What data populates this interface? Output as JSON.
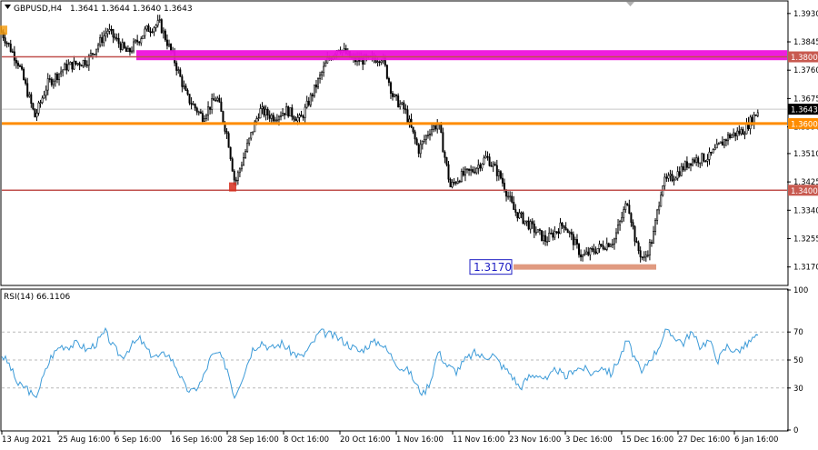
{
  "window": {
    "symbol_label": "GBPUSD,H4",
    "ohlc_label": "1.3641 1.3644 1.3640 1.3643",
    "indicator_label": "RSI(14) 66.1106"
  },
  "colors": {
    "candle": "#000000",
    "magenta_zone": "#ee11dd",
    "orange_line": "#ff8c00",
    "red_line": "#c0504d",
    "support_bar": "#e09a80",
    "rsi_line": "#3d9bd8",
    "badge_blue_border": "#1f1fc4",
    "current_price_badge": "#000000",
    "price_badge": "#c85a50",
    "marker_orange": "#f39c12",
    "marker_red": "#d62b1b"
  },
  "chart_data": [
    {
      "type": "candlestick",
      "symbol": "GBPUSD",
      "timeframe": "H4",
      "ylim": [
        1.312,
        1.3965
      ],
      "y_ticks": [
        "1.3930",
        "1.3845",
        "1.3760",
        "1.3675",
        "1.3590",
        "1.3510",
        "1.3425",
        "1.3340",
        "1.3255",
        "1.3170"
      ],
      "x_ticks": [
        "13 Aug 2021",
        "25 Aug 16:00",
        "6 Sep 16:00",
        "16 Sep 16:00",
        "28 Sep 16:00",
        "8 Oct 16:00",
        "20 Oct 16:00",
        "1 Nov 16:00",
        "11 Nov 16:00",
        "23 Nov 16:00",
        "3 Dec 16:00",
        "15 Dec 16:00",
        "27 Dec 16:00",
        "6 Jan 16:00"
      ],
      "price_path": [
        [
          0,
          1.388
        ],
        [
          20,
          1.378
        ],
        [
          38,
          1.362
        ],
        [
          52,
          1.372
        ],
        [
          72,
          1.377
        ],
        [
          96,
          1.379
        ],
        [
          118,
          1.388
        ],
        [
          140,
          1.381
        ],
        [
          160,
          1.388
        ],
        [
          175,
          1.39
        ],
        [
          190,
          1.38
        ],
        [
          205,
          1.368
        ],
        [
          222,
          1.362
        ],
        [
          238,
          1.368
        ],
        [
          250,
          1.356
        ],
        [
          258,
          1.342
        ],
        [
          270,
          1.352
        ],
        [
          285,
          1.364
        ],
        [
          300,
          1.362
        ],
        [
          315,
          1.364
        ],
        [
          330,
          1.361
        ],
        [
          345,
          1.37
        ],
        [
          360,
          1.379
        ],
        [
          372,
          1.383
        ],
        [
          388,
          1.379
        ],
        [
          405,
          1.379
        ],
        [
          420,
          1.38
        ],
        [
          432,
          1.368
        ],
        [
          445,
          1.364
        ],
        [
          460,
          1.352
        ],
        [
          472,
          1.358
        ],
        [
          482,
          1.36
        ],
        [
          495,
          1.341
        ],
        [
          505,
          1.344
        ],
        [
          520,
          1.346
        ],
        [
          535,
          1.35
        ],
        [
          550,
          1.344
        ],
        [
          565,
          1.334
        ],
        [
          580,
          1.33
        ],
        [
          600,
          1.325
        ],
        [
          620,
          1.33
        ],
        [
          640,
          1.32
        ],
        [
          660,
          1.323
        ],
        [
          675,
          1.325
        ],
        [
          690,
          1.337
        ],
        [
          700,
          1.323
        ],
        [
          708,
          1.319
        ],
        [
          718,
          1.326
        ],
        [
          728,
          1.342
        ],
        [
          740,
          1.344
        ],
        [
          760,
          1.349
        ],
        [
          780,
          1.35
        ],
        [
          800,
          1.356
        ],
        [
          818,
          1.358
        ],
        [
          835,
          1.3643
        ]
      ],
      "last_price": 1.3643,
      "price_badges": [
        {
          "label": "1.3800",
          "price": 1.38,
          "style": "red"
        },
        {
          "label": "1.3643",
          "price": 1.3643,
          "style": "current"
        },
        {
          "label": "1.3600",
          "price": 1.36,
          "style": "orange"
        },
        {
          "label": "1.3400",
          "price": 1.34,
          "style": "red"
        }
      ],
      "levels": [
        {
          "type": "zone",
          "price_top": 1.382,
          "price_bottom": 1.379,
          "x_from": 150,
          "color_key": "magenta_zone"
        },
        {
          "type": "line",
          "price": 1.38,
          "color_key": "red_line"
        },
        {
          "type": "line",
          "price": 1.36,
          "color_key": "orange_line"
        },
        {
          "type": "line",
          "price": 1.34,
          "color_key": "red_line"
        },
        {
          "type": "bar",
          "price": 1.317,
          "x_from": 565,
          "x_to": 722,
          "label": "1.3170",
          "color_key": "support_bar"
        }
      ],
      "markers": [
        {
          "x": 4,
          "price": 1.388,
          "color_key": "marker_orange"
        },
        {
          "x": 256,
          "price": 1.341,
          "color_key": "marker_red"
        }
      ]
    },
    {
      "type": "line",
      "name": "RSI(14)",
      "ylim": [
        0,
        100
      ],
      "y_ticks": [
        100,
        70,
        50,
        30,
        0
      ],
      "levels": [
        70,
        50,
        30
      ],
      "last_value": 66.1106,
      "values_path": [
        [
          0,
          55
        ],
        [
          10,
          47
        ],
        [
          20,
          32
        ],
        [
          30,
          30
        ],
        [
          38,
          22
        ],
        [
          46,
          35
        ],
        [
          56,
          52
        ],
        [
          66,
          60
        ],
        [
          76,
          60
        ],
        [
          86,
          62
        ],
        [
          96,
          57
        ],
        [
          106,
          62
        ],
        [
          116,
          70
        ],
        [
          124,
          60
        ],
        [
          134,
          52
        ],
        [
          144,
          60
        ],
        [
          154,
          65
        ],
        [
          164,
          55
        ],
        [
          174,
          52
        ],
        [
          184,
          55
        ],
        [
          194,
          45
        ],
        [
          204,
          30
        ],
        [
          212,
          27
        ],
        [
          222,
          35
        ],
        [
          232,
          52
        ],
        [
          240,
          55
        ],
        [
          250,
          44
        ],
        [
          258,
          24
        ],
        [
          268,
          40
        ],
        [
          278,
          58
        ],
        [
          288,
          63
        ],
        [
          298,
          58
        ],
        [
          310,
          62
        ],
        [
          320,
          56
        ],
        [
          332,
          52
        ],
        [
          342,
          60
        ],
        [
          352,
          70
        ],
        [
          364,
          68
        ],
        [
          374,
          65
        ],
        [
          386,
          60
        ],
        [
          396,
          56
        ],
        [
          408,
          62
        ],
        [
          418,
          63
        ],
        [
          428,
          55
        ],
        [
          440,
          45
        ],
        [
          450,
          42
        ],
        [
          460,
          30
        ],
        [
          466,
          26
        ],
        [
          474,
          36
        ],
        [
          482,
          56
        ],
        [
          492,
          46
        ],
        [
          502,
          42
        ],
        [
          512,
          50
        ],
        [
          522,
          55
        ],
        [
          532,
          52
        ],
        [
          542,
          54
        ],
        [
          552,
          46
        ],
        [
          562,
          40
        ],
        [
          572,
          30
        ],
        [
          582,
          38
        ],
        [
          592,
          40
        ],
        [
          602,
          35
        ],
        [
          612,
          44
        ],
        [
          622,
          37
        ],
        [
          632,
          44
        ],
        [
          642,
          44
        ],
        [
          652,
          40
        ],
        [
          662,
          46
        ],
        [
          672,
          40
        ],
        [
          682,
          52
        ],
        [
          690,
          64
        ],
        [
          698,
          52
        ],
        [
          706,
          40
        ],
        [
          714,
          50
        ],
        [
          722,
          56
        ],
        [
          732,
          70
        ],
        [
          742,
          67
        ],
        [
          752,
          62
        ],
        [
          760,
          70
        ],
        [
          770,
          60
        ],
        [
          780,
          64
        ],
        [
          790,
          50
        ],
        [
          800,
          60
        ],
        [
          810,
          56
        ],
        [
          820,
          60
        ],
        [
          830,
          66
        ],
        [
          835,
          66.1
        ]
      ]
    }
  ]
}
